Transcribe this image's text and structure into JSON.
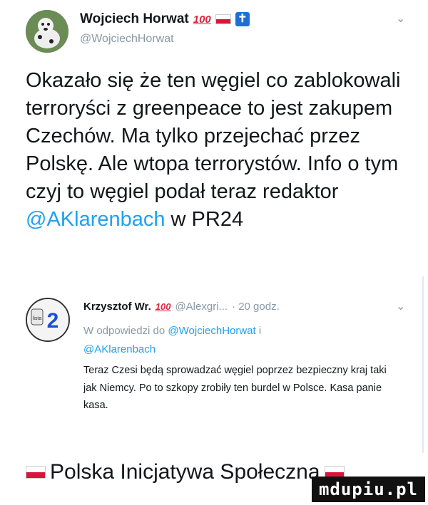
{
  "tweet": {
    "author_name": "Wojciech Horwat",
    "author_emoji": "100",
    "author_handle": "@WojciechHorwat",
    "text_before": "Okazało się że ten węgiel co zablokowali terroryści z greenpeace to jest zakupem Czechów. Ma tylko przejechać przez Polskę. Ale wtopa terrorystów. Info o tym czyj to węgiel podał teraz redaktor ",
    "mention": "@AKlarenbach",
    "text_after": " w PR24"
  },
  "reply": {
    "author_name": "Krzysztof Wr.",
    "author_emoji": "100",
    "author_handle": "@Alexgri...",
    "time": "· 20 godz.",
    "reply_prefix": "W odpowiedzi do",
    "mention_1": "@WojciechHorwat",
    "reply_conj": "i",
    "mention_2": "@AKlarenbach",
    "text": "Teraz Czesi będą sprowadzać węgiel poprzez bezpieczny kraj taki jak Niemcy. Po to szkopy zrobiły ten burdel w Polsce. Kasa panie kasa."
  },
  "footer": {
    "label": "Polska Inicjatywa Społeczna"
  },
  "watermark": {
    "text": "mdupiu.pl"
  },
  "colors": {
    "link": "#1da1f2",
    "muted": "#8899a6",
    "flag_red": "#dc143c"
  },
  "icons": [
    "avatar-dog",
    "flag-poland-icon",
    "cross-icon",
    "chevron-down-icon"
  ]
}
